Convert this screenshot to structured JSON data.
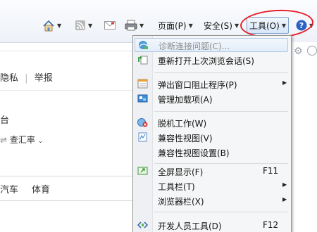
{
  "toolbar": {
    "page_label": "页面(P)",
    "safety_label": "安全(S)",
    "tools_label": "工具(O)",
    "dropdown_glyph": "▼"
  },
  "background": {
    "links": [
      "隐私",
      "|",
      "举报"
    ],
    "text_tai": "台",
    "text_rate": "查汇率",
    "tabs": [
      "汽车",
      "体育"
    ]
  },
  "menu": {
    "items": [
      {
        "label": "诊断连接问题(C)...",
        "shortcut": "",
        "submenu": false,
        "disabled": true,
        "icon": "diagnose-icon"
      },
      {
        "label": "重新打开上次浏览会话(S)",
        "shortcut": "",
        "submenu": false,
        "disabled": false,
        "icon": "reopen-session-icon"
      },
      {
        "label": "弹出窗口阻止程序(P)",
        "shortcut": "",
        "submenu": true,
        "disabled": false,
        "icon": "popup-blocker-icon"
      },
      {
        "label": "管理加载项(A)",
        "shortcut": "",
        "submenu": false,
        "disabled": false,
        "icon": "addons-icon"
      },
      {
        "label": "脱机工作(W)",
        "shortcut": "",
        "submenu": false,
        "disabled": false,
        "icon": "offline-icon"
      },
      {
        "label": "兼容性视图(V)",
        "shortcut": "",
        "submenu": false,
        "disabled": false,
        "icon": "compat-view-icon"
      },
      {
        "label": "兼容性视图设置(B)",
        "shortcut": "",
        "submenu": false,
        "disabled": false,
        "icon": ""
      },
      {
        "label": "全屏显示(F)",
        "shortcut": "F11",
        "submenu": false,
        "disabled": false,
        "icon": "fullscreen-icon"
      },
      {
        "label": "工具栏(T)",
        "shortcut": "",
        "submenu": true,
        "disabled": false,
        "icon": ""
      },
      {
        "label": "浏览器栏(X)",
        "shortcut": "",
        "submenu": true,
        "disabled": false,
        "icon": ""
      },
      {
        "label": "开发人员工具(D)",
        "shortcut": "F12",
        "submenu": false,
        "disabled": false,
        "icon": "devtools-icon"
      }
    ],
    "submenu_glyph": "▶"
  },
  "colors": {
    "annotation": "#e8202a",
    "highlight_border": "#b3c9e6"
  }
}
